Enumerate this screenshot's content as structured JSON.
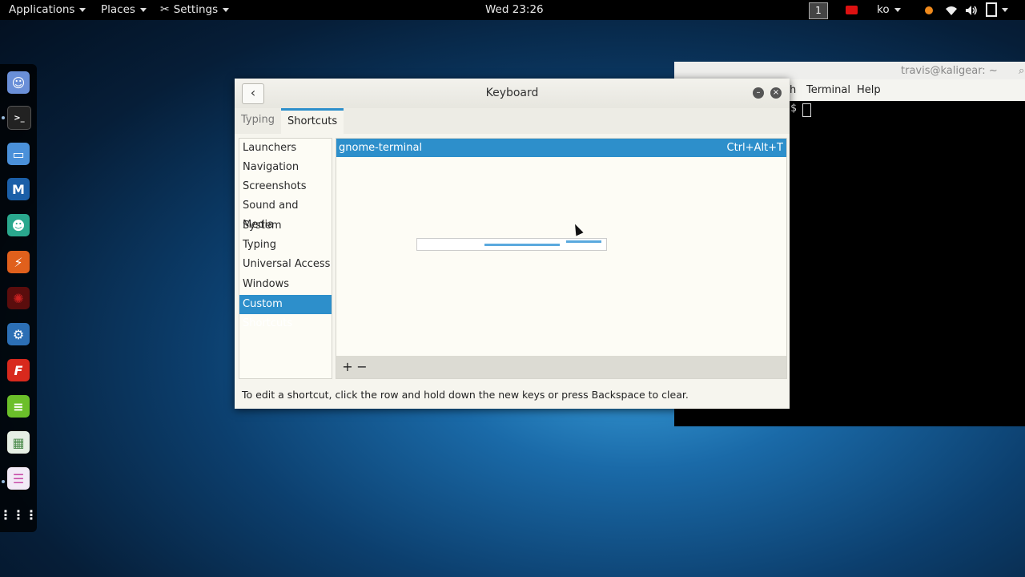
{
  "topbar": {
    "applications": "Applications",
    "places": "Places",
    "settings": "Settings",
    "clock": "Wed 23:26",
    "workspace": "1",
    "input_method": "ko"
  },
  "dock": {
    "apps": [
      "chat-app-icon",
      "terminal-app-icon",
      "files-app-icon",
      "metasploit-app-icon",
      "anime-app-icon",
      "burp-app-icon",
      "redapp-icon",
      "maltego-app-icon",
      "faraday-app-icon",
      "notes-app-icon",
      "calculator-app-icon",
      "toggle-app-icon",
      "show-apps-icon"
    ]
  },
  "terminal": {
    "title": "travis@kaligear: ~",
    "menu_partial": "h",
    "menu_terminal": "Terminal",
    "menu_help": "Help",
    "prompt": "$"
  },
  "dialog": {
    "title": "Keyboard",
    "tabs": [
      "Typing",
      "Shortcuts"
    ],
    "categories": [
      "Launchers",
      "Navigation",
      "Screenshots",
      "Sound and Media",
      "System",
      "Typing",
      "Universal Access",
      "Windows",
      "Custom Shortcuts"
    ],
    "selected_category": "Custom Shortcuts",
    "shortcut": {
      "name": "gnome-terminal",
      "accel": "Ctrl+Alt+T"
    },
    "add_label": "+",
    "remove_label": "−",
    "hint": "To edit a shortcut, click the row and hold down the new keys or press Backspace to clear."
  }
}
